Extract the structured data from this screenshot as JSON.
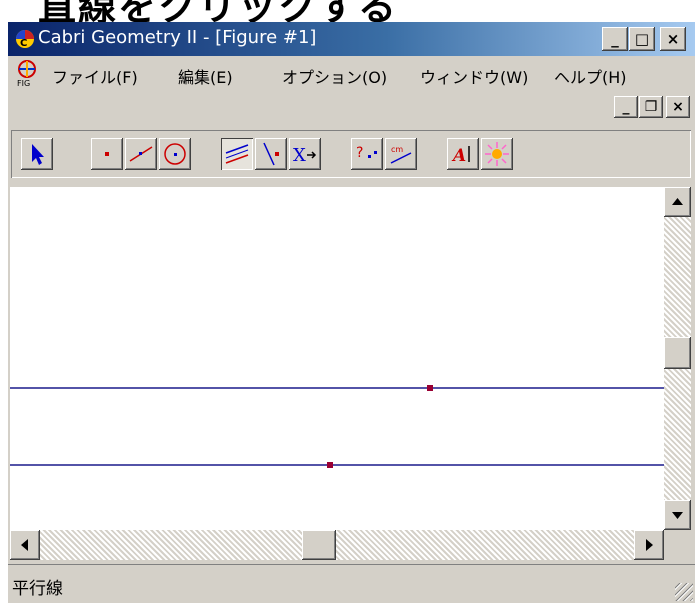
{
  "top_caption": "直線をクリックする",
  "window": {
    "title": "Cabri Geometry II - [Figure #1]",
    "minimize_label": "_",
    "maximize_label": "□",
    "close_label": "×"
  },
  "menu": {
    "items": [
      {
        "label": "ファイル(F)"
      },
      {
        "label": "編集(E)"
      },
      {
        "label": "オプション(O)"
      },
      {
        "label": "ウィンドウ(W)"
      },
      {
        "label": "ヘルプ(H)"
      }
    ]
  },
  "child_controls": {
    "minimize_label": "_",
    "restore_label": "❐",
    "close_label": "×"
  },
  "toolbar": {
    "tools": [
      {
        "name": "pointer-tool",
        "pressed": false
      },
      {
        "name": "point-tool",
        "pressed": false
      },
      {
        "name": "line-tool",
        "pressed": false
      },
      {
        "name": "circle-tool",
        "pressed": false
      },
      {
        "name": "parallel-line-tool",
        "pressed": true
      },
      {
        "name": "symmetry-tool",
        "pressed": false
      },
      {
        "name": "transform-tool",
        "pressed": false
      },
      {
        "name": "check-property-tool",
        "pressed": false
      },
      {
        "name": "measure-tool",
        "pressed": false
      },
      {
        "name": "label-tool",
        "pressed": false
      },
      {
        "name": "display-tool",
        "pressed": false
      }
    ]
  },
  "colors": {
    "line": "#1a1a8c",
    "point": "#990033",
    "title_start": "#0a246a",
    "title_end": "#a6caf0"
  },
  "status": {
    "text": "平行線"
  }
}
